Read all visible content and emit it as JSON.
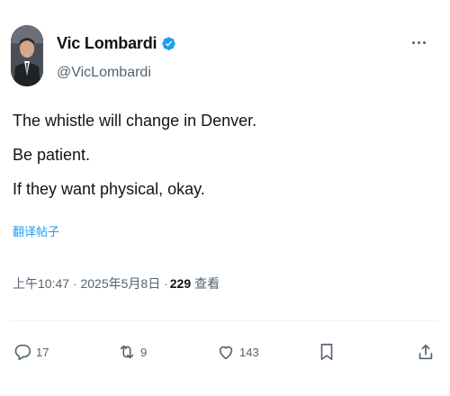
{
  "author": {
    "display_name": "Vic Lombardi",
    "handle": "@VicLombardi",
    "verified": true
  },
  "tweet": {
    "lines": [
      "The whistle will change in Denver.",
      "Be patient.",
      "If they want physical, okay."
    ],
    "translate_label": "翻译帖子"
  },
  "meta": {
    "timestamp": "上午10:47 · 2025年5月8日 · ",
    "views_count": "229",
    "views_label": "查看"
  },
  "actions": {
    "reply_count": "17",
    "repost_count": "9",
    "like_count": "143"
  },
  "colors": {
    "accent": "#1d9bf0",
    "text": "#0f1419",
    "muted": "#536471"
  },
  "icons": [
    "verified-badge-icon",
    "more-icon",
    "reply-icon",
    "repost-icon",
    "like-icon",
    "bookmark-icon",
    "share-icon"
  ]
}
